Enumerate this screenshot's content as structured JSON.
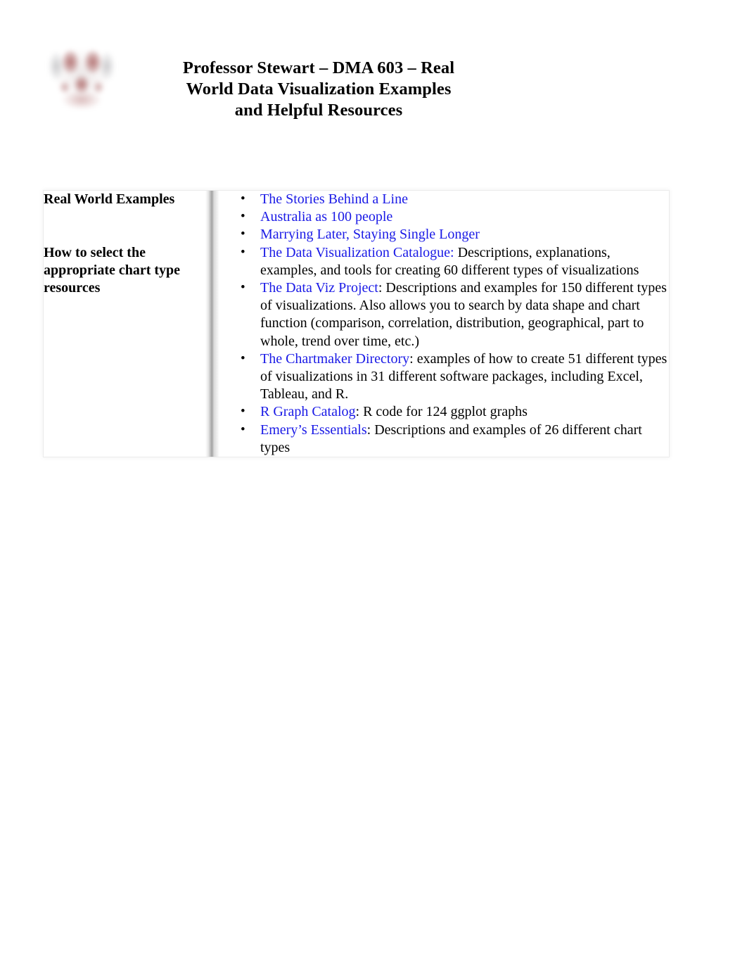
{
  "header": {
    "logo_icon": "university-seal-icon",
    "title_lines": [
      "Professor Stewart – DMA 603 – Real",
      "World Data Visualization Examples",
      "and Helpful Resources"
    ]
  },
  "colors": {
    "link": "#1a1ae6",
    "text": "#000000",
    "divider": "#6a6a6a",
    "page_background": "#ffffff"
  },
  "table": {
    "rows": [
      {
        "label": "Real World Examples",
        "items": [
          {
            "link": "The Stories Behind a Line",
            "text": ""
          },
          {
            "link": "Australia as 100 people",
            "text": ""
          },
          {
            "link": "Marrying Later, Staying Single Longer",
            "text": ""
          }
        ]
      },
      {
        "label": "How to select the appropriate chart type resources",
        "items": [
          {
            "link": "The Data Visualization Catalogue:",
            "text": " Descriptions, explanations, examples, and tools for creating 60 different types of visualizations"
          },
          {
            "link": "The Data Viz Project",
            "text": ": Descriptions and examples for 150 different types of visualizations. Also allows you to search by data shape and chart function (comparison, correlation, distribution, geographical, part to whole, trend over time, etc.)"
          },
          {
            "link": "The Chartmaker Directory",
            "text": ": examples of how to create 51 different types of visualizations in 31 different software packages, including Excel, Tableau, and R."
          },
          {
            "link": "R Graph Catalog",
            "text": ": R code for 124 ggplot graphs"
          },
          {
            "link": "Emery’s Essentials",
            "text": ": Descriptions and examples of 26 different chart types"
          }
        ]
      }
    ]
  }
}
